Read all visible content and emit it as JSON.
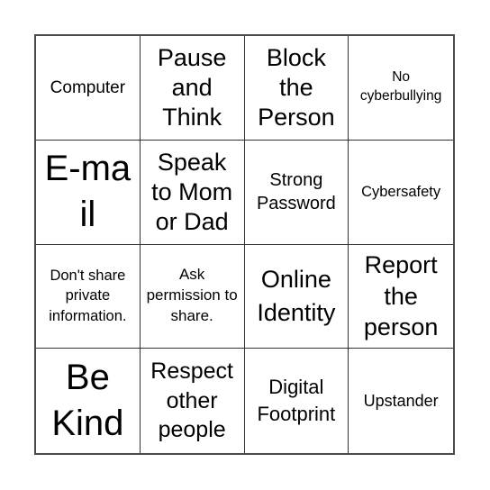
{
  "bingo_card": {
    "cells": [
      "Computer",
      "Pause and Think",
      "Block the Person",
      "No cyberbullying",
      "E-mail",
      "Speak to Mom or Dad",
      "Strong Password",
      "Cybersafety",
      "Don't share private information.",
      "Ask permission to share.",
      "Online Identity",
      "Report the person",
      "Be Kind",
      "Respect other people",
      "Digital Footprint",
      "Upstander"
    ]
  }
}
